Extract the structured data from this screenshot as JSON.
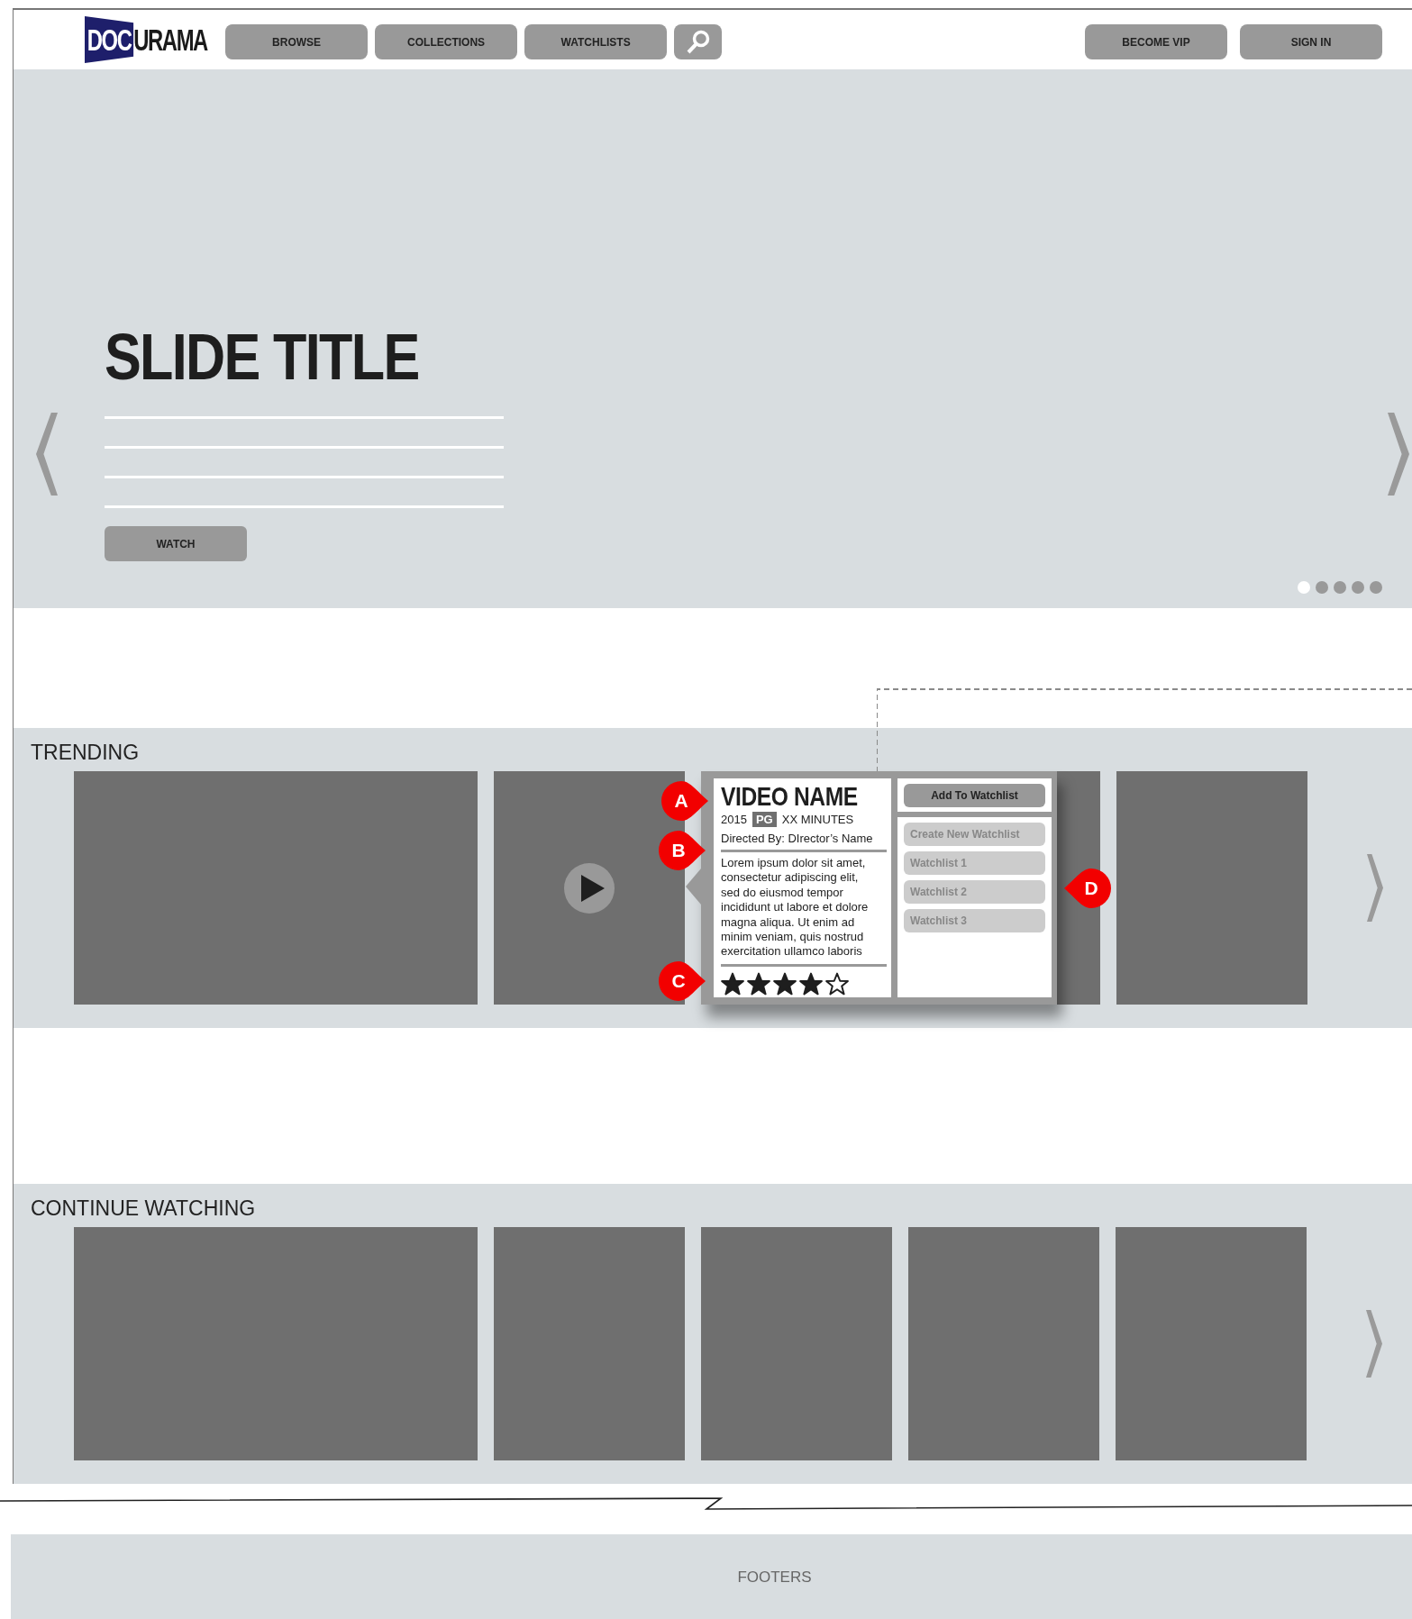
{
  "logo": {
    "part_1": "DOC",
    "part_2": "URAMA"
  },
  "nav": [
    "BROWSE",
    "COLLECTIONS",
    "WATCHLISTS"
  ],
  "nav_right": [
    "BECOME VIP",
    "SIGN IN"
  ],
  "hero": {
    "title": "SLIDE TITLE",
    "button": "WATCH",
    "dots": [
      {
        "selected": true
      },
      {
        "selected": false
      },
      {
        "selected": false
      },
      {
        "selected": false
      },
      {
        "selected": false
      }
    ]
  },
  "trending": {
    "title": "TRENDING",
    "items": [
      {
        "kind": "wide"
      },
      {
        "kind": "play"
      },
      {
        "kind": "popup",
        "title": "VIDEO NAME",
        "year": "2015",
        "rating": "PG",
        "duration": "XX MINUTES",
        "director": "Directed By: DIrector’s Name",
        "description": "Lorem ipsum dolor sit amet, consectetur adipiscing elit, sed do eiusmod tempor incididunt ut labore et dolore magna aliqua. Ut enim ad minim veniam, quis nostrud exercitation ullamco laboris",
        "stars": 4,
        "add_button": "Add To Watchlist",
        "watchlists": [
          "Create New Watchlist",
          "Watchlist 1",
          "Watchlist 2",
          "Watchlist 3"
        ],
        "markers": [
          "A",
          "B",
          "C",
          "D"
        ]
      },
      {
        "kind": "plain"
      },
      {
        "kind": "plain"
      }
    ]
  },
  "continue_watching": {
    "title": "CONTINUE WATCHING",
    "items": [
      {
        "kind": "wide"
      },
      {
        "kind": "plain"
      },
      {
        "kind": "plain"
      },
      {
        "kind": "plain"
      },
      {
        "kind": "plain"
      }
    ]
  },
  "footer": "FOOTERS"
}
